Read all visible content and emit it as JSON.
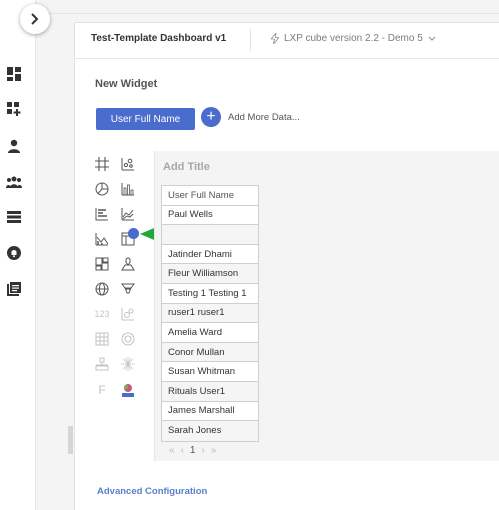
{
  "header": {
    "dashboard_title": "Test-Template Dashboard v1",
    "cube_selector": "LXP cube version 2.2 - Demo 5"
  },
  "sidebar": {
    "icons": [
      "dashboard-icon",
      "add-widget-icon",
      "user-icon",
      "group-icon",
      "list-icon",
      "notification-icon",
      "library-icon"
    ]
  },
  "widget": {
    "title": "New Widget",
    "selected_field": "User Full Name",
    "add_more_label": "Add More Data...",
    "add_title_placeholder": "Add Title",
    "advanced_config": "Advanced Configuration"
  },
  "chart_types": {
    "icons": [
      "table-grid-icon",
      "scatter-icon",
      "pie-icon",
      "bar-chart-icon",
      "horizontal-bar-icon",
      "line-chart-icon",
      "combo-chart-icon",
      "table-icon",
      "treemap-icon",
      "map-icon",
      "globe-icon",
      "funnel-icon",
      "number-icon",
      "bubble-icon",
      "heatmap-icon",
      "gauge-icon",
      "sankey-icon",
      "radial-icon",
      "text-icon",
      "image-icon"
    ],
    "text_icon_label": "F",
    "number_icon_label": "123"
  },
  "table": {
    "header": "User Full Name",
    "rows": [
      "Paul Wells",
      "",
      "Jatinder Dhami",
      "Fleur Williamson",
      "Testing 1 Testing 1",
      "ruser1 ruser1",
      "Amelia Ward",
      "Conor Mullan",
      "Susan Whitman",
      "Rituals User1",
      "James Marshall",
      "Sarah Jones"
    ]
  },
  "pagination": {
    "first": "«",
    "prev": "‹",
    "current": "1",
    "next": "›",
    "last": "»"
  },
  "colors": {
    "accent": "#4a6ccc",
    "annotation_arrow": "#22a83a"
  }
}
